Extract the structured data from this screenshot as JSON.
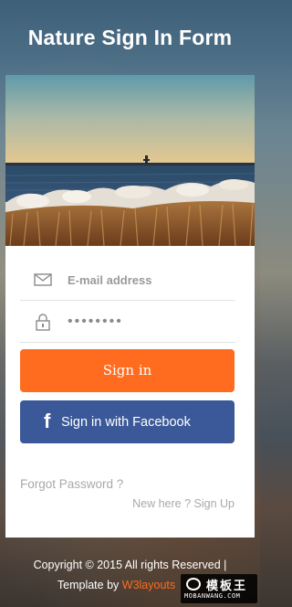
{
  "header": {
    "title": "Nature Sign In Form"
  },
  "hero": {
    "alt": "Sunset over the lake with a rocky shore and dry grass"
  },
  "form": {
    "email": {
      "placeholder": "E-mail address",
      "icon": "envelope-icon"
    },
    "password": {
      "value": "••••••••",
      "icon": "lock-icon"
    },
    "signin_label": "Sign in",
    "facebook_label": "Sign in with Facebook",
    "facebook_icon": "f"
  },
  "links": {
    "forgot": "Forgot Password ?",
    "new_here": "New here ?",
    "signup": "Sign Up"
  },
  "footer": {
    "copyright": "Copyright © 2015 All rights Reserved |",
    "template_by": "Template by",
    "author": "W3layouts"
  },
  "watermark": {
    "main": "模板王",
    "sub": "MOBANWANG.COM"
  },
  "colors": {
    "accent": "#ff6c1f",
    "facebook": "#3b5998",
    "muted_text": "#a9a9a9"
  }
}
